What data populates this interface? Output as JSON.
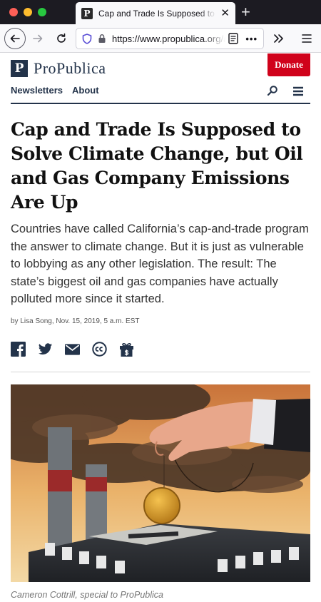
{
  "browser": {
    "tab_title": "Cap and Trade Is Supposed to Solve Climate Change, but Oil and Gas Company Emissions Are Up",
    "tab_favicon": "P",
    "url": "https://www.propublica.org/article/cap-and-trade-is-supposed-to-solve-climate-change-but-oil-and-gas-company-emissions-are-up",
    "new_tab_glyph": "+",
    "close_glyph": "✕",
    "more_glyph": "•••",
    "icons": [
      "back-arrow-icon",
      "forward-arrow-icon",
      "reload-icon",
      "shield-icon",
      "lock-icon",
      "reader-view-icon",
      "overflow-chevrons-icon",
      "hamburger-menu-icon"
    ]
  },
  "site": {
    "logo_mark": "P",
    "logo_text": "ProPublica",
    "donate_label": "Donate",
    "nav": [
      "Newsletters",
      "About"
    ],
    "brand_color": "#23334a",
    "donate_color": "#d0021b"
  },
  "article": {
    "headline": "Cap and Trade Is Supposed to Solve Climate Change, but Oil and Gas Company Emissions Are Up",
    "dek": "Countries have called California’s cap-and-trade program the answer to climate change. But it is just as vulnerable to lobbying as any other legislation. The result: The state’s biggest oil and gas companies have actually polluted more since it started.",
    "byline": "by Lisa Song, Nov. 15, 2019, 5 a.m. EST",
    "share_icons": [
      "facebook-icon",
      "twitter-icon",
      "email-icon",
      "creative-commons-icon",
      "gift-icon"
    ],
    "image_caption": "Cameron Cottrill, special to ProPublica"
  }
}
